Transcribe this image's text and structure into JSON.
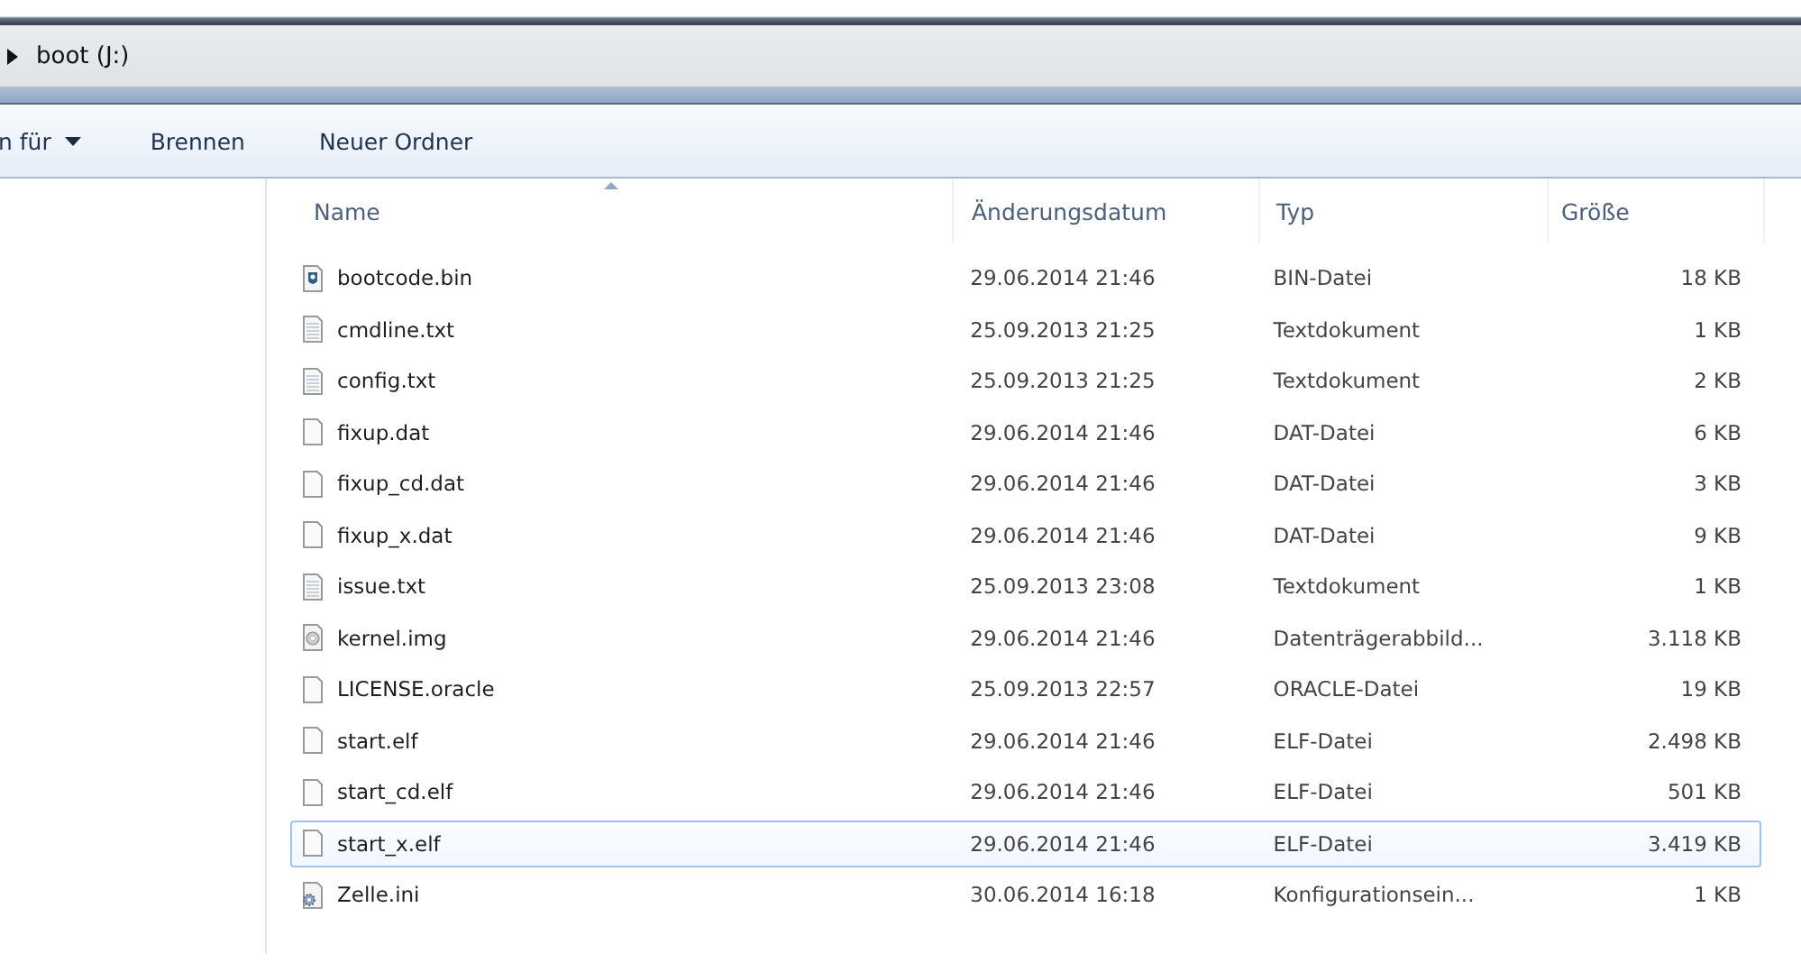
{
  "address_bar": {
    "path": "boot (J:)"
  },
  "toolbar": {
    "buttons": [
      {
        "label": "n für",
        "dropdown": true
      },
      {
        "label": "Brennen",
        "dropdown": false
      },
      {
        "label": "Neuer Ordner",
        "dropdown": false
      }
    ]
  },
  "table": {
    "columns": [
      {
        "label": "Name",
        "sorted": true
      },
      {
        "label": "Änderungsdatum",
        "sorted": false
      },
      {
        "label": "Typ",
        "sorted": false
      },
      {
        "label": "Größe",
        "sorted": false
      }
    ],
    "rows": [
      {
        "name": "bootcode.bin",
        "kind": "binary",
        "date": "29.06.2014 21:46",
        "type": "BIN-Datei",
        "size": "18 KB",
        "selected": false
      },
      {
        "name": "cmdline.txt",
        "kind": "text",
        "date": "25.09.2013 21:25",
        "type": "Textdokument",
        "size": "1 KB",
        "selected": false
      },
      {
        "name": "config.txt",
        "kind": "text",
        "date": "25.09.2013 21:25",
        "type": "Textdokument",
        "size": "2 KB",
        "selected": false
      },
      {
        "name": "fixup.dat",
        "kind": "blank",
        "date": "29.06.2014 21:46",
        "type": "DAT-Datei",
        "size": "6 KB",
        "selected": false
      },
      {
        "name": "fixup_cd.dat",
        "kind": "blank",
        "date": "29.06.2014 21:46",
        "type": "DAT-Datei",
        "size": "3 KB",
        "selected": false
      },
      {
        "name": "fixup_x.dat",
        "kind": "blank",
        "date": "29.06.2014 21:46",
        "type": "DAT-Datei",
        "size": "9 KB",
        "selected": false
      },
      {
        "name": "issue.txt",
        "kind": "text",
        "date": "25.09.2013 23:08",
        "type": "Textdokument",
        "size": "1 KB",
        "selected": false
      },
      {
        "name": "kernel.img",
        "kind": "disc",
        "date": "29.06.2014 21:46",
        "type": "Datenträgerabbild...",
        "size": "3.118 KB",
        "selected": false
      },
      {
        "name": "LICENSE.oracle",
        "kind": "blank",
        "date": "25.09.2013 22:57",
        "type": "ORACLE-Datei",
        "size": "19 KB",
        "selected": false
      },
      {
        "name": "start.elf",
        "kind": "blank",
        "date": "29.06.2014 21:46",
        "type": "ELF-Datei",
        "size": "2.498 KB",
        "selected": false
      },
      {
        "name": "start_cd.elf",
        "kind": "blank",
        "date": "29.06.2014 21:46",
        "type": "ELF-Datei",
        "size": "501 KB",
        "selected": false
      },
      {
        "name": "start_x.elf",
        "kind": "blank",
        "date": "29.06.2014 21:46",
        "type": "ELF-Datei",
        "size": "3.419 KB",
        "selected": true
      },
      {
        "name": "Zelle.ini",
        "kind": "settings",
        "date": "30.06.2014 16:18",
        "type": "Konfigurationsein...",
        "size": "1 KB",
        "selected": false
      }
    ]
  }
}
